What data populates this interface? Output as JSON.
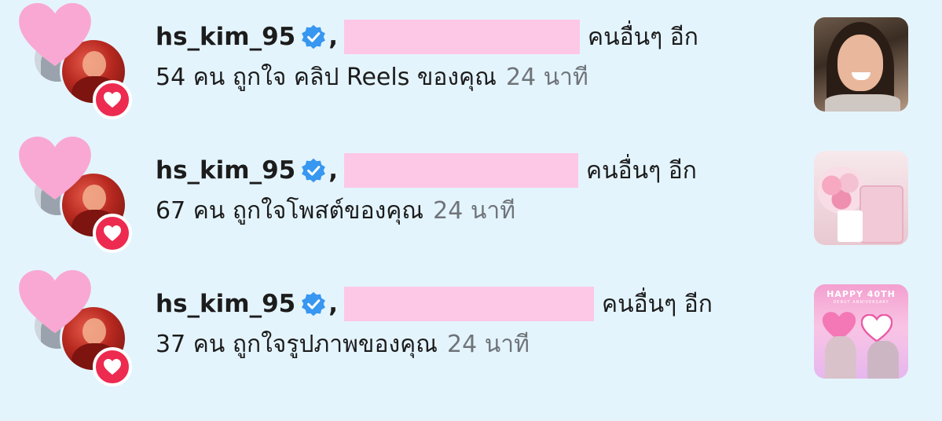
{
  "notifications": [
    {
      "username": "hs_kim_95",
      "others_text": "คนอื่นๆ อีก",
      "action_text": "54 คน ถูกใจ คลิป Reels ของคุณ",
      "time": "24 นาที",
      "thumbnail": "woman-portrait-photo"
    },
    {
      "username": "hs_kim_95",
      "others_text": "คนอื่นๆ อีก",
      "action_text": "67 คน ถูกใจโพสต์ของคุณ",
      "time": "24 นาที",
      "thumbnail": "flowers-and-gift-box-photo"
    },
    {
      "username": "hs_kim_95",
      "others_text": "คนอื่นๆ อีก",
      "action_text": "37 คน ถูกใจรูปภาพของคุณ",
      "time": "24 นาที",
      "thumbnail": "anniversary-poster-image",
      "thumbnail_text": "HAPPY 40TH",
      "thumbnail_subtext": "DEBUT ANNIVERSARY"
    }
  ],
  "icons": {
    "verified": "verified-badge-icon",
    "like": "heart-icon",
    "sticker": "pink-heart-sticker-icon"
  },
  "colors": {
    "background": "#e4f4fd",
    "like_badge": "#ed2a4f",
    "verified": "#3897f0",
    "redaction": "#fdc7e6",
    "sticker": "#f9a8d4"
  }
}
